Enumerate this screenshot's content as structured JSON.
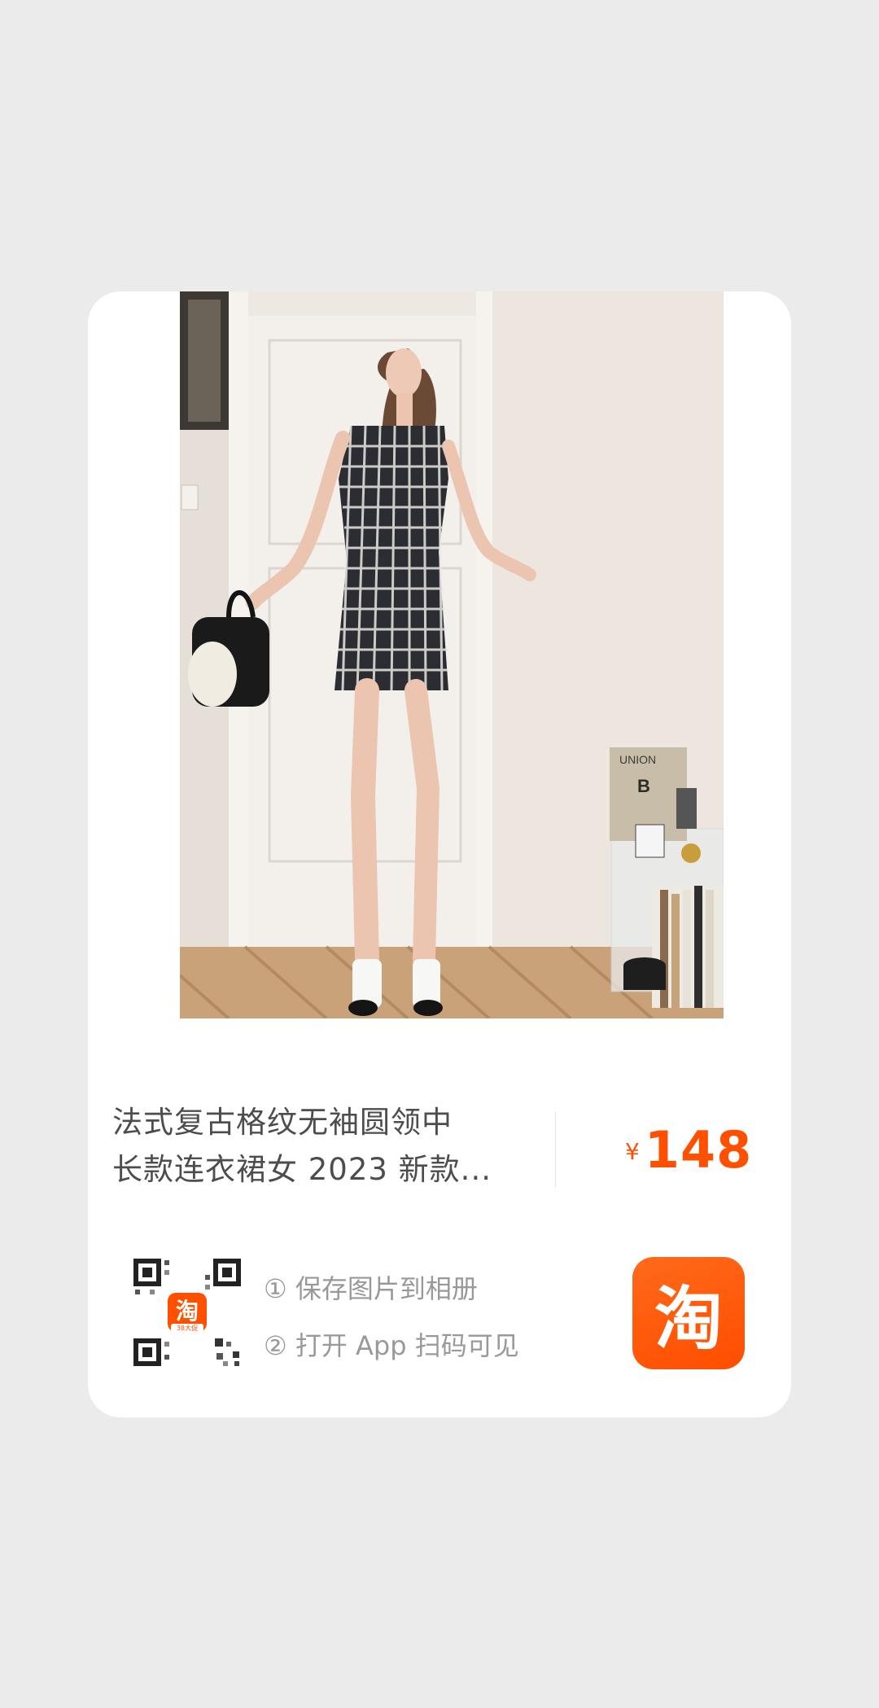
{
  "product": {
    "title_line1": "法式复古格纹无袖圆领中",
    "title_line2": "长款连衣裙女 2023 新款...",
    "currency": "¥",
    "price": "148"
  },
  "share": {
    "step1": "① 保存图片到相册",
    "step2": "② 打开 App 扫码可见",
    "qr_badge_text": "淘",
    "qr_badge_sub": "38大促",
    "logo_char": "淘"
  },
  "photo": {
    "poster_text": "UNION",
    "poster_letter": "B"
  },
  "colors": {
    "background": "#ebebeb",
    "price": "#ff5000",
    "brand": "#ff5000"
  }
}
